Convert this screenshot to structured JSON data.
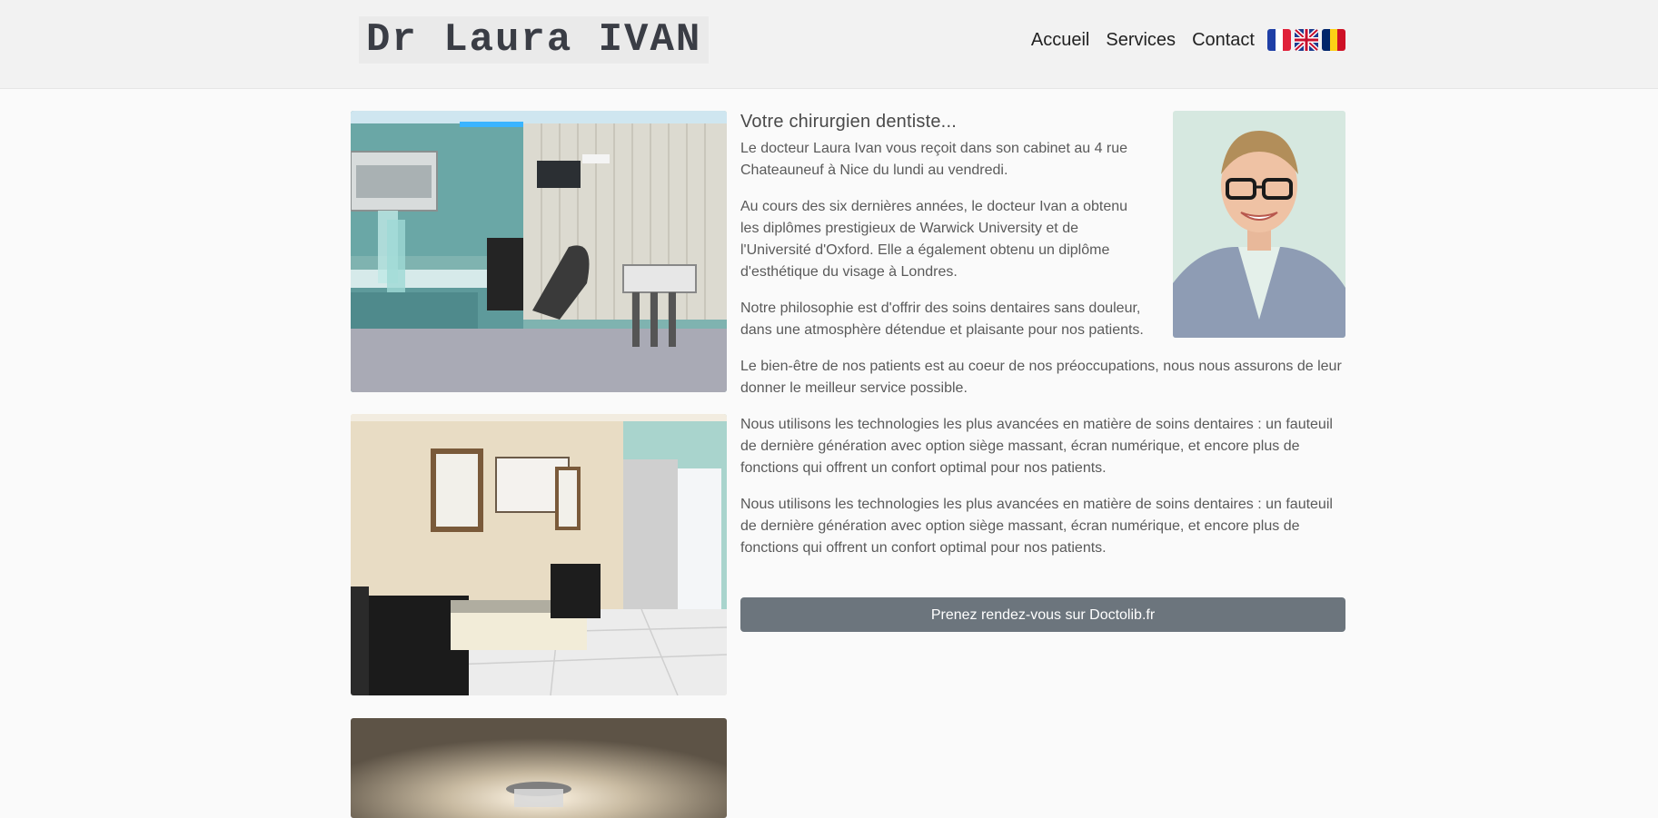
{
  "header": {
    "logo_text": "Dr Laura IVAN",
    "nav": [
      {
        "label": "Accueil"
      },
      {
        "label": "Services"
      },
      {
        "label": "Contact"
      }
    ],
    "flags": [
      "french-flag-icon",
      "uk-flag-icon",
      "romanian-flag-icon"
    ]
  },
  "main": {
    "title": "Votre chirurgien dentiste...",
    "paragraphs": [
      "Le docteur Laura Ivan vous reçoit dans son cabinet au 4 rue Chateauneuf à Nice du lundi au vendredi.",
      "Au cours des six dernières années, le docteur Ivan a obtenu les diplômes prestigieux de Warwick University et de l'Université d'Oxford. Elle a également obtenu un diplôme d'esthétique du visage à Londres.",
      "Notre philosophie est d'offrir des soins dentaires sans douleur, dans une atmosphère détendue et plaisante pour nos patients.",
      "Le bien-être de nos patients est au coeur de nos préoccupations, nous nous assurons de leur donner le meilleur service possible.",
      "Nous utilisons les technologies les plus avancées en matière de soins dentaires : un fauteuil de dernière génération avec option siège massant, écran numérique, et encore plus de fonctions qui offrent un confort optimal pour nos patients.",
      "Nous utilisons les technologies les plus avancées en matière de soins dentaires : un fauteuil de dernière génération avec option siège massant, écran numérique, et encore plus de fonctions qui offrent un confort optimal pour nos patients."
    ],
    "cta_label": "Prenez rendez-vous sur Doctolib.fr"
  },
  "colors": {
    "header_bg": "#f2f2f2",
    "page_bg": "#fafafa",
    "button_bg": "#6c757d"
  }
}
